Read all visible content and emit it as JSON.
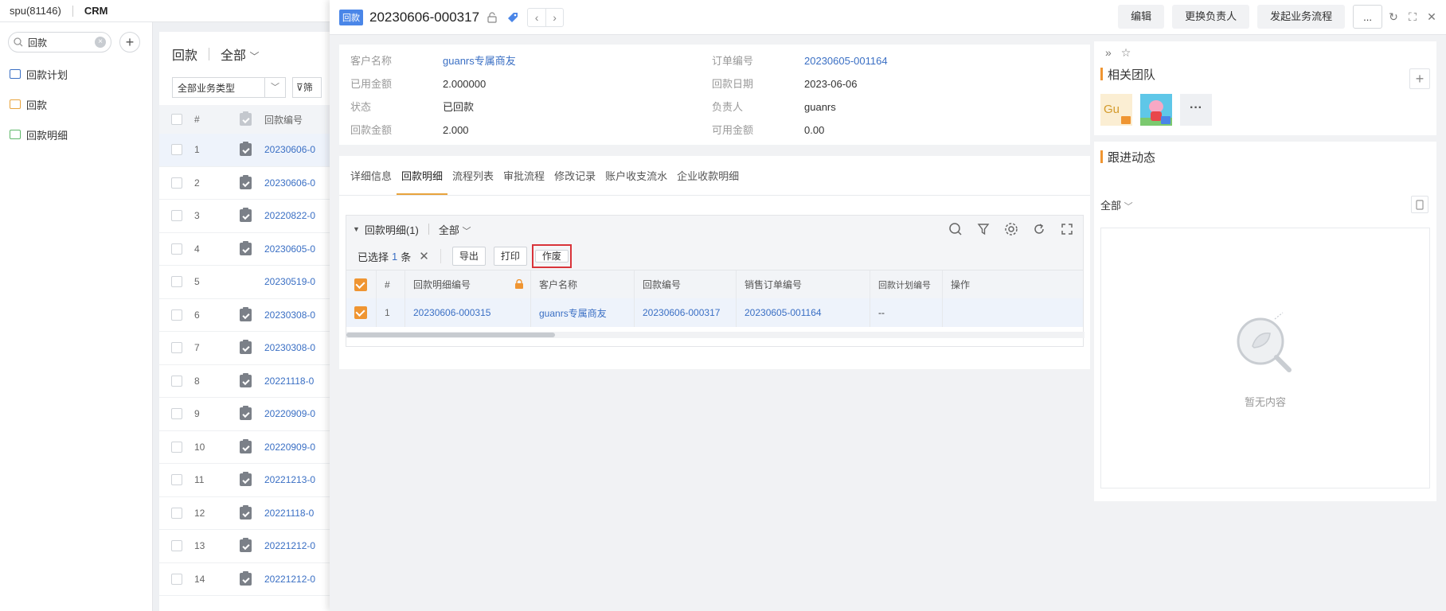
{
  "topbar": {
    "tenant": "spu(81146)",
    "app": "CRM"
  },
  "sidebar": {
    "search_value": "回款",
    "items": [
      {
        "label": "回款计划",
        "icon": "plan-icon"
      },
      {
        "label": "回款",
        "icon": "payment-icon"
      },
      {
        "label": "回款明细",
        "icon": "payment-detail-icon"
      }
    ]
  },
  "list": {
    "title": "回款",
    "scope": "全部",
    "business_type": "全部业务类型",
    "filter_label": "筛",
    "col_num": "#",
    "col_id": "回款编号",
    "rows": [
      {
        "n": "1",
        "id": "20230606-0"
      },
      {
        "n": "2",
        "id": "20230606-0"
      },
      {
        "n": "3",
        "id": "20220822-0"
      },
      {
        "n": "4",
        "id": "20230605-0"
      },
      {
        "n": "5",
        "id": "20230519-0"
      },
      {
        "n": "6",
        "id": "20230308-0"
      },
      {
        "n": "7",
        "id": "20230308-0"
      },
      {
        "n": "8",
        "id": "20221118-0"
      },
      {
        "n": "9",
        "id": "20220909-0"
      },
      {
        "n": "10",
        "id": "20220909-0"
      },
      {
        "n": "11",
        "id": "20221213-0"
      },
      {
        "n": "12",
        "id": "20221118-0"
      },
      {
        "n": "13",
        "id": "20221212-0"
      },
      {
        "n": "14",
        "id": "20221212-0"
      }
    ]
  },
  "detail": {
    "badge": "回款",
    "record_no": "20230606-000317",
    "actions": {
      "edit": "编辑",
      "change_owner": "更换负责人",
      "start_flow": "发起业务流程",
      "more": "..."
    },
    "info": {
      "customer_label": "客户名称",
      "customer_value": "guanrs专属商友",
      "order_label": "订单编号",
      "order_value": "20230605-001164",
      "used_label": "已用金额",
      "used_value": "2.000000",
      "date_label": "回款日期",
      "date_value": "2023-06-06",
      "status_label": "状态",
      "status_value": "已回款",
      "owner_label": "负责人",
      "owner_value": "guanrs",
      "amount_label": "回款金额",
      "amount_value": "2.000",
      "available_label": "可用金额",
      "available_value": "0.00"
    },
    "tabs": [
      "详细信息",
      "回款明细",
      "流程列表",
      "审批流程",
      "修改记录",
      "账户收支流水",
      "企业收款明细"
    ],
    "sub": {
      "title": "回款明细(1)",
      "scope": "全部",
      "selected_prefix": "已选择",
      "selected_count": "1",
      "selected_suffix": "条",
      "btn_export": "导出",
      "btn_print": "打印",
      "btn_void": "作废",
      "columns": [
        "#",
        "回款明细编号",
        "客户名称",
        "回款编号",
        "销售订单编号",
        "回款计划编号",
        "操作"
      ],
      "row": {
        "n": "1",
        "detail_no": "20230606-000315",
        "customer": "guanrs专属商友",
        "payment_no": "20230606-000317",
        "order_no": "20230605-001164",
        "plan_no": "--"
      }
    }
  },
  "team": {
    "title": "相关团队",
    "avatar_initials": "Gu",
    "more": "···"
  },
  "follow": {
    "title": "跟进动态",
    "scope": "全部",
    "empty": "暂无内容"
  }
}
